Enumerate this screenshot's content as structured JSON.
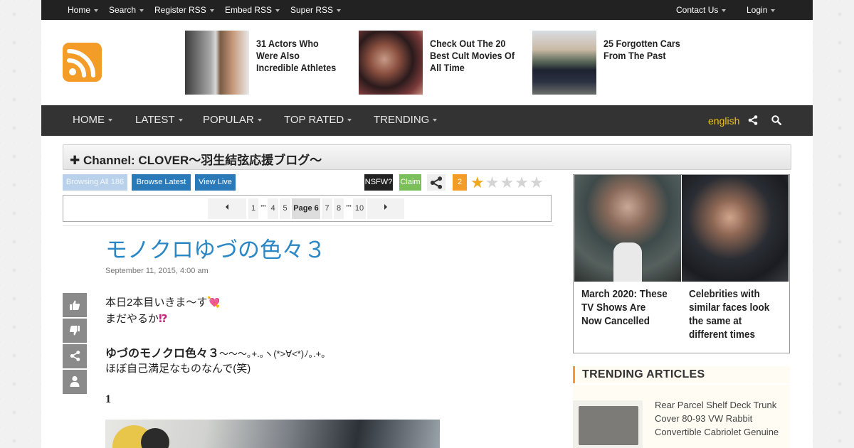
{
  "topnav": {
    "left": [
      {
        "label": "Home"
      },
      {
        "label": "Search"
      },
      {
        "label": "Register RSS"
      },
      {
        "label": "Embed RSS"
      },
      {
        "label": "Super RSS"
      }
    ],
    "right": [
      {
        "label": "Contact Us"
      },
      {
        "label": "Login"
      }
    ]
  },
  "promos": [
    {
      "title": "31 Actors Who Were Also Incredible Athletes"
    },
    {
      "title": "Check Out The 20 Best Cult Movies Of All Time"
    },
    {
      "title": "25 Forgotten Cars From The Past"
    }
  ],
  "mainnav": {
    "items": [
      {
        "label": "HOME"
      },
      {
        "label": "LATEST"
      },
      {
        "label": "POPULAR"
      },
      {
        "label": "TOP RATED"
      },
      {
        "label": "TRENDING"
      }
    ],
    "language": "english"
  },
  "channel": {
    "title": "Channel: CLOVER～羽生結弦応援ブログ～"
  },
  "actions": {
    "browsing_all": "Browsing All 186",
    "browse_latest": "Browse Latest",
    "view_live": "View Live",
    "nsfw": "NSFW?",
    "claim": "Claim",
    "count": "2",
    "rating": 1,
    "rating_max": 5,
    "colors": {
      "blue": "#2a7ab9",
      "orange": "#f39c27",
      "green": "#7bbf5a"
    }
  },
  "pager": {
    "pages": [
      "1",
      "4",
      "5",
      "Page 6",
      "7",
      "8",
      "10"
    ],
    "ellipsis": "•••",
    "current": "Page 6"
  },
  "article": {
    "title": "モノクロゆづの色々３",
    "date": "September 11, 2015, 4:00 am",
    "line1": "本日2本目いきま～す",
    "line2": "まだやるか",
    "line3_bold": "ゆづのモノクロ色々３",
    "line3_rest": "～～～｡+.｡ヽ(*>∀<*)ﾉ｡.+｡",
    "line4": "ほぼ自己満足なものなんで(笑)",
    "section_number": "1"
  },
  "sidebar": {
    "celebs": [
      {
        "title": "March 2020: These TV Shows Are Now Cancelled"
      },
      {
        "title": "Celebrities with similar faces look the same at different times"
      }
    ],
    "trending_heading": "TRENDING ARTICLES",
    "trending": [
      {
        "title": "Rear Parcel Shelf Deck Trunk Cover 80-93 VW Rabbit Convertible Cabriolet Genuine"
      }
    ]
  }
}
